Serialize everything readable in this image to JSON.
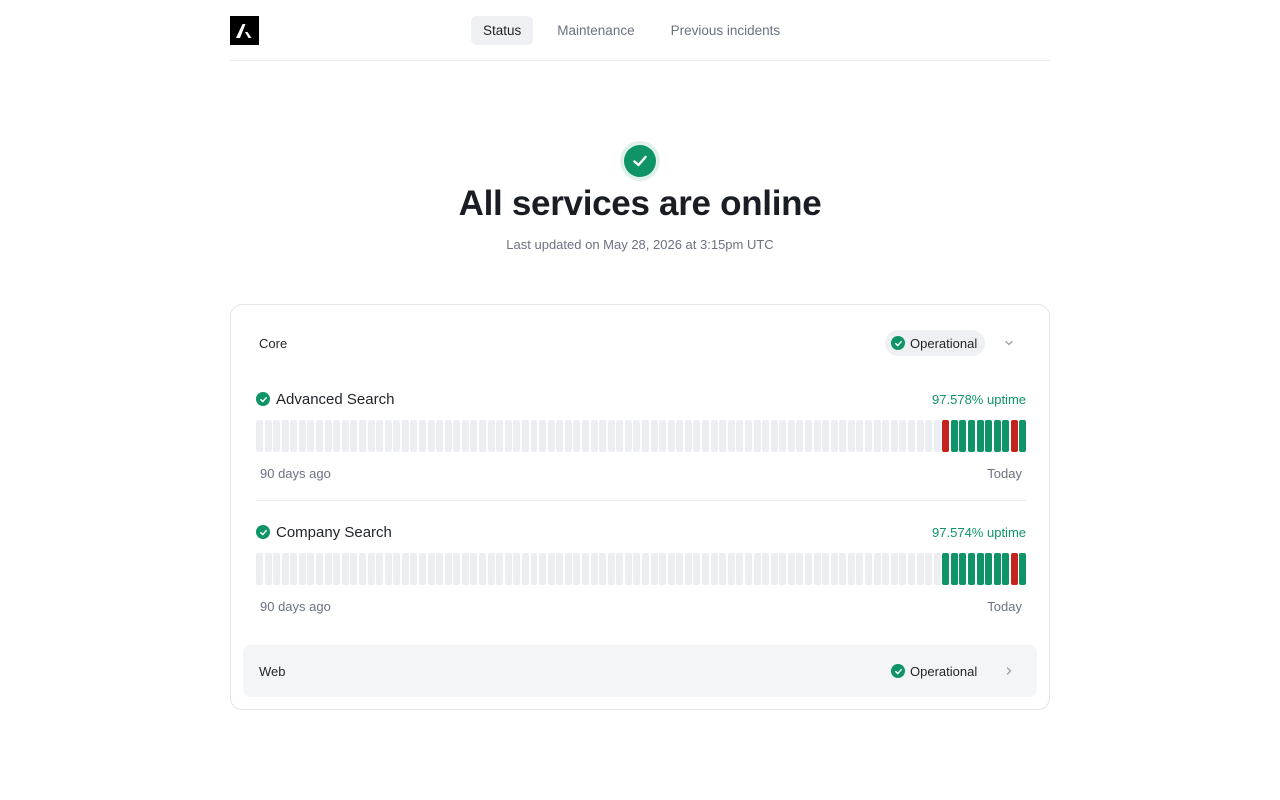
{
  "nav": {
    "tabs": [
      {
        "label": "Status",
        "active": true
      },
      {
        "label": "Maintenance",
        "active": false
      },
      {
        "label": "Previous incidents",
        "active": false
      }
    ]
  },
  "hero": {
    "title": "All services are online",
    "subtitle": "Last updated on May 28, 2026 at 3:15pm UTC",
    "icon": "check-circle-icon"
  },
  "groups": [
    {
      "name": "Core",
      "status": "Operational",
      "expanded": true,
      "services": [
        {
          "name": "Advanced Search",
          "uptime": "97.578% uptime",
          "range_start": "90 days ago",
          "range_end": "Today",
          "days": [
            "none",
            "none",
            "none",
            "none",
            "none",
            "none",
            "none",
            "none",
            "none",
            "none",
            "none",
            "none",
            "none",
            "none",
            "none",
            "none",
            "none",
            "none",
            "none",
            "none",
            "none",
            "none",
            "none",
            "none",
            "none",
            "none",
            "none",
            "none",
            "none",
            "none",
            "none",
            "none",
            "none",
            "none",
            "none",
            "none",
            "none",
            "none",
            "none",
            "none",
            "none",
            "none",
            "none",
            "none",
            "none",
            "none",
            "none",
            "none",
            "none",
            "none",
            "none",
            "none",
            "none",
            "none",
            "none",
            "none",
            "none",
            "none",
            "none",
            "none",
            "none",
            "none",
            "none",
            "none",
            "none",
            "none",
            "none",
            "none",
            "none",
            "none",
            "none",
            "none",
            "none",
            "none",
            "none",
            "none",
            "none",
            "none",
            "none",
            "none",
            "down",
            "ok",
            "ok",
            "ok",
            "ok",
            "ok",
            "ok",
            "ok",
            "down",
            "ok"
          ]
        },
        {
          "name": "Company Search",
          "uptime": "97.574% uptime",
          "range_start": "90 days ago",
          "range_end": "Today",
          "days": [
            "none",
            "none",
            "none",
            "none",
            "none",
            "none",
            "none",
            "none",
            "none",
            "none",
            "none",
            "none",
            "none",
            "none",
            "none",
            "none",
            "none",
            "none",
            "none",
            "none",
            "none",
            "none",
            "none",
            "none",
            "none",
            "none",
            "none",
            "none",
            "none",
            "none",
            "none",
            "none",
            "none",
            "none",
            "none",
            "none",
            "none",
            "none",
            "none",
            "none",
            "none",
            "none",
            "none",
            "none",
            "none",
            "none",
            "none",
            "none",
            "none",
            "none",
            "none",
            "none",
            "none",
            "none",
            "none",
            "none",
            "none",
            "none",
            "none",
            "none",
            "none",
            "none",
            "none",
            "none",
            "none",
            "none",
            "none",
            "none",
            "none",
            "none",
            "none",
            "none",
            "none",
            "none",
            "none",
            "none",
            "none",
            "none",
            "none",
            "none",
            "ok",
            "ok",
            "ok",
            "ok",
            "ok",
            "ok",
            "ok",
            "ok",
            "down",
            "ok"
          ]
        }
      ]
    },
    {
      "name": "Web",
      "status": "Operational",
      "expanded": false
    }
  ],
  "colors": {
    "operational": "#0f9467",
    "outage": "#c4241d",
    "no_data": "#eceef1"
  }
}
